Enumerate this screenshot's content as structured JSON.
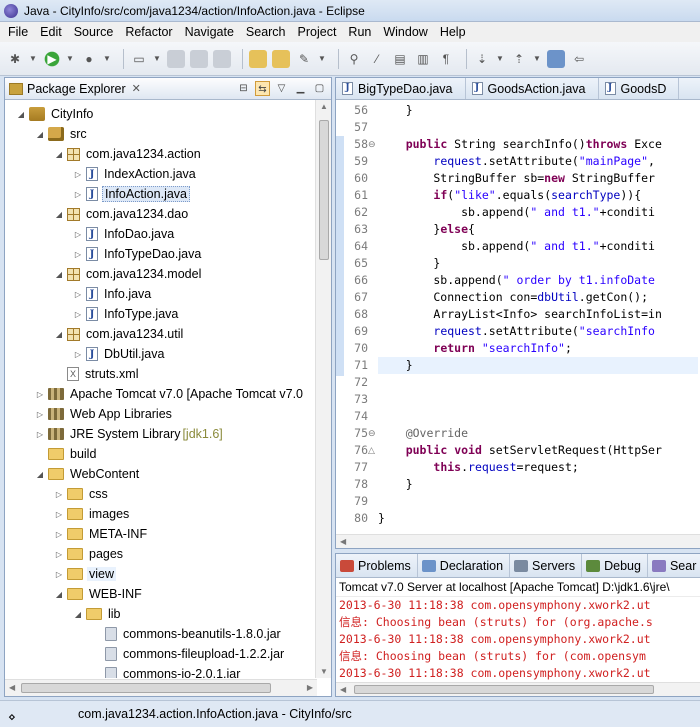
{
  "window": {
    "title": "Java - CityInfo/src/com/java1234/action/InfoAction.java - Eclipse"
  },
  "menu": [
    "File",
    "Edit",
    "Source",
    "Refactor",
    "Navigate",
    "Search",
    "Project",
    "Run",
    "Window",
    "Help"
  ],
  "package_explorer": {
    "title": "Package Explorer",
    "tree": [
      {
        "label": "CityInfo",
        "icon": "project-icon",
        "depth": 0,
        "twisty": "open"
      },
      {
        "label": "src",
        "icon": "source-folder-icon",
        "depth": 1,
        "twisty": "open"
      },
      {
        "label": "com.java1234.action",
        "icon": "package-icon",
        "depth": 2,
        "twisty": "open"
      },
      {
        "label": "IndexAction.java",
        "icon": "java-file-icon",
        "depth": 3,
        "twisty": "closed"
      },
      {
        "label": "InfoAction.java",
        "icon": "java-file-icon",
        "depth": 3,
        "twisty": "closed",
        "selected": true
      },
      {
        "label": "com.java1234.dao",
        "icon": "package-icon",
        "depth": 2,
        "twisty": "open"
      },
      {
        "label": "InfoDao.java",
        "icon": "java-file-icon",
        "depth": 3,
        "twisty": "closed"
      },
      {
        "label": "InfoTypeDao.java",
        "icon": "java-file-icon",
        "depth": 3,
        "twisty": "closed"
      },
      {
        "label": "com.java1234.model",
        "icon": "package-icon",
        "depth": 2,
        "twisty": "open"
      },
      {
        "label": "Info.java",
        "icon": "java-file-icon",
        "depth": 3,
        "twisty": "closed"
      },
      {
        "label": "InfoType.java",
        "icon": "java-file-icon",
        "depth": 3,
        "twisty": "closed"
      },
      {
        "label": "com.java1234.util",
        "icon": "package-icon",
        "depth": 2,
        "twisty": "open"
      },
      {
        "label": "DbUtil.java",
        "icon": "java-file-icon",
        "depth": 3,
        "twisty": "closed"
      },
      {
        "label": "struts.xml",
        "icon": "xml-file-icon",
        "depth": 2,
        "twisty": "none"
      },
      {
        "label": "Apache Tomcat v7.0 [Apache Tomcat v7.0",
        "icon": "library-icon",
        "depth": 1,
        "twisty": "closed"
      },
      {
        "label": "Web App Libraries",
        "icon": "library-icon",
        "depth": 1,
        "twisty": "closed"
      },
      {
        "label": "JRE System Library",
        "decoration": "[jdk1.6]",
        "icon": "library-icon",
        "depth": 1,
        "twisty": "closed"
      },
      {
        "label": "build",
        "icon": "folder-icon",
        "depth": 1,
        "twisty": "none"
      },
      {
        "label": "WebContent",
        "icon": "folder-icon",
        "depth": 1,
        "twisty": "open"
      },
      {
        "label": "css",
        "icon": "folder-icon",
        "depth": 2,
        "twisty": "closed"
      },
      {
        "label": "images",
        "icon": "folder-icon",
        "depth": 2,
        "twisty": "closed"
      },
      {
        "label": "META-INF",
        "icon": "folder-icon",
        "depth": 2,
        "twisty": "closed"
      },
      {
        "label": "pages",
        "icon": "folder-icon",
        "depth": 2,
        "twisty": "closed"
      },
      {
        "label": "view",
        "icon": "folder-icon",
        "depth": 2,
        "twisty": "closed",
        "hover": true
      },
      {
        "label": "WEB-INF",
        "icon": "folder-icon",
        "depth": 2,
        "twisty": "open"
      },
      {
        "label": "lib",
        "icon": "folder-icon",
        "depth": 3,
        "twisty": "open"
      },
      {
        "label": "commons-beanutils-1.8.0.jar",
        "icon": "jar-icon",
        "depth": 4,
        "twisty": "none"
      },
      {
        "label": "commons-fileupload-1.2.2.jar",
        "icon": "jar-icon",
        "depth": 4,
        "twisty": "none"
      },
      {
        "label": "commons-io-2.0.1.jar",
        "icon": "jar-icon",
        "depth": 4,
        "twisty": "none"
      }
    ]
  },
  "editor": {
    "tabs": [
      "BigTypeDao.java",
      "GoodsAction.java",
      "GoodsD"
    ],
    "lines": [
      {
        "n": "56",
        "html": "    }"
      },
      {
        "n": "57",
        "html": ""
      },
      {
        "n": "58",
        "html": "    <span class=\"kw\">public</span> String searchInfo()<span class=\"kw\">throws</span> Exce",
        "fold": "minus"
      },
      {
        "n": "59",
        "html": "        <span class=\"fld\">request</span>.setAttribute(<span class=\"str\">\"mainPage\"</span>,"
      },
      {
        "n": "60",
        "html": "        StringBuffer sb=<span class=\"kw\">new</span> StringBuffer"
      },
      {
        "n": "61",
        "html": "        <span class=\"kw\">if</span>(<span class=\"str\">\"like\"</span>.equals(<span class=\"fld\">searchType</span>)){"
      },
      {
        "n": "62",
        "html": "            sb.append(<span class=\"str\">\" and t1.\"</span>+conditi"
      },
      {
        "n": "63",
        "html": "        }<span class=\"kw\">else</span>{"
      },
      {
        "n": "64",
        "html": "            sb.append(<span class=\"str\">\" and t1.\"</span>+conditi"
      },
      {
        "n": "65",
        "html": "        }"
      },
      {
        "n": "66",
        "html": "        sb.append(<span class=\"str\">\" order by t1.infoDate</span>"
      },
      {
        "n": "67",
        "html": "        Connection con=<span class=\"fld\">dbUtil</span>.getCon();"
      },
      {
        "n": "68",
        "html": "        ArrayList&lt;Info&gt; searchInfoList=in"
      },
      {
        "n": "69",
        "html": "        <span class=\"fld\">request</span>.setAttribute(<span class=\"str\">\"searchInfo</span>"
      },
      {
        "n": "70",
        "html": "        <span class=\"kw\">return</span> <span class=\"str\">\"searchInfo\"</span>;"
      },
      {
        "n": "71",
        "html": "    }",
        "current": true
      },
      {
        "n": "72",
        "html": ""
      },
      {
        "n": "73",
        "html": ""
      },
      {
        "n": "74",
        "html": ""
      },
      {
        "n": "75",
        "html": "    <span class=\"ann\">@Override</span>",
        "fold": "minus"
      },
      {
        "n": "76",
        "html": "    <span class=\"kw\">public</span> <span class=\"kw\">void</span> setServletRequest(HttpSer",
        "fold": "triangle"
      },
      {
        "n": "77",
        "html": "        <span class=\"kw\">this</span>.<span class=\"fld\">request</span>=request;"
      },
      {
        "n": "78",
        "html": "    }"
      },
      {
        "n": "79",
        "html": ""
      },
      {
        "n": "80",
        "html": "}"
      }
    ]
  },
  "console": {
    "tabs": [
      {
        "label": "Problems",
        "color": "#c94a3a"
      },
      {
        "label": "Declaration",
        "color": "#6c93c9"
      },
      {
        "label": "Servers",
        "color": "#7a8aa0"
      },
      {
        "label": "Debug",
        "color": "#5c8a3c"
      },
      {
        "label": "Sear",
        "color": "#8a7ac0"
      }
    ],
    "title": "Tomcat v7.0 Server at localhost [Apache Tomcat] D:\\jdk1.6\\jre\\",
    "lines": [
      "2013-6-30 11:18:38 com.opensymphony.xwork2.ut",
      "信息: Choosing bean (struts) for (org.apache.s",
      "2013-6-30 11:18:38 com.opensymphony.xwork2.ut",
      "信息: Choosing bean (struts) for (com.opensym",
      "2013-6-30 11:18:38 com.opensymphony.xwork2.ut"
    ]
  },
  "status": {
    "text": "com.java1234.action.InfoAction.java - CityInfo/src"
  }
}
